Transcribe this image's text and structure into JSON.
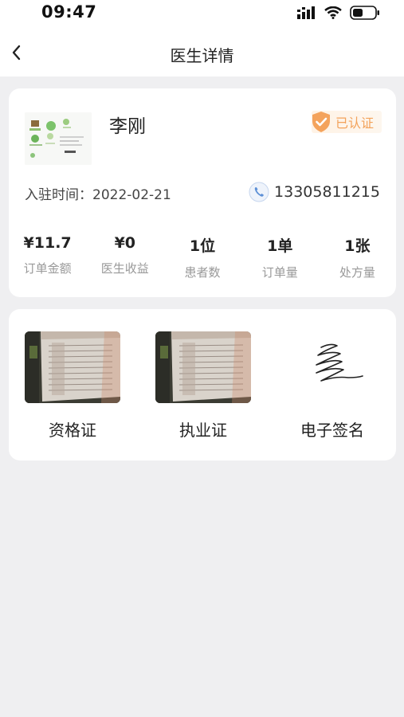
{
  "status_bar": {
    "time": "09:47"
  },
  "nav": {
    "title": "医生详情"
  },
  "profile": {
    "name": "李刚",
    "badge": "已认证",
    "join_label": "入驻时间：",
    "join_date": "2022-02-21",
    "phone": "13305811215"
  },
  "stats": [
    {
      "value": "¥11.7",
      "label": "订单金额"
    },
    {
      "value": "¥0",
      "label": "医生收益"
    },
    {
      "value": "1位",
      "label": "患者数"
    },
    {
      "value": "1单",
      "label": "订单量"
    },
    {
      "value": "1张",
      "label": "处方量"
    }
  ],
  "certificates": [
    {
      "label": "资格证"
    },
    {
      "label": "执业证"
    },
    {
      "label": "电子签名"
    }
  ],
  "colors": {
    "background": "#efeff1",
    "card": "#ffffff",
    "badge_orange": "#f3a25a",
    "phone_blue": "#5b8fd6"
  }
}
